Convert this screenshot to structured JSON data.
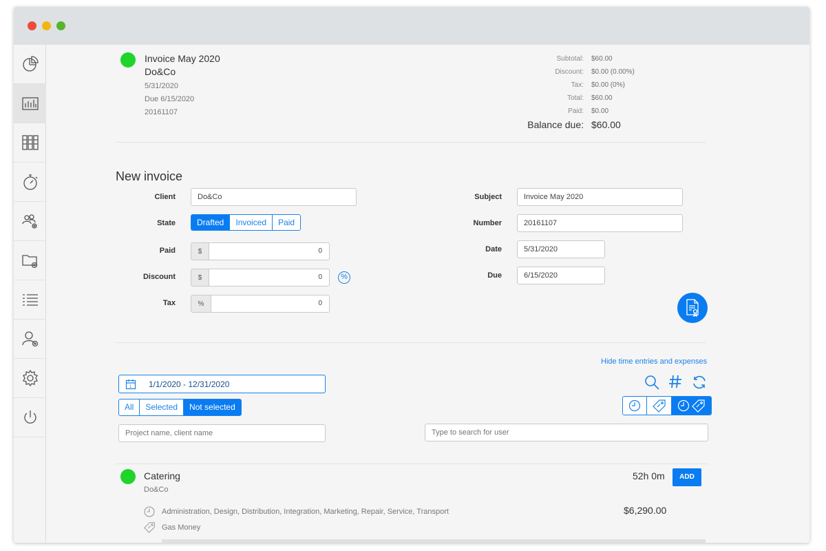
{
  "sidebar": {
    "items": [
      {
        "name": "sidebar-item-dashboard",
        "icon": "pie-chart-icon"
      },
      {
        "name": "sidebar-item-reports",
        "icon": "bar-chart-icon"
      },
      {
        "name": "sidebar-item-invoices",
        "icon": "binders-icon"
      },
      {
        "name": "sidebar-item-timer",
        "icon": "stopwatch-icon"
      },
      {
        "name": "sidebar-item-teams",
        "icon": "people-gear-icon"
      },
      {
        "name": "sidebar-item-projects",
        "icon": "folder-gear-icon"
      },
      {
        "name": "sidebar-item-lists",
        "icon": "list-icon"
      },
      {
        "name": "sidebar-item-users",
        "icon": "user-gear-icon"
      },
      {
        "name": "sidebar-item-settings",
        "icon": "gear-icon"
      },
      {
        "name": "sidebar-item-logout",
        "icon": "power-icon"
      }
    ],
    "active_index": 1
  },
  "invoice_summary": {
    "title": "Invoice May 2020",
    "client": "Do&Co",
    "date": "5/31/2020",
    "due": "Due 6/15/2020",
    "number": "20161107",
    "status_color": "#1fd42b"
  },
  "totals": {
    "subtotal_label": "Subtotal:",
    "subtotal": "$60.00",
    "discount_label": "Discount:",
    "discount": "$0.00 (0.00%)",
    "tax_label": "Tax:",
    "tax": "$0.00 (0%)",
    "total_label": "Total:",
    "total": "$60.00",
    "paid_label": "Paid:",
    "paid": "$0.00",
    "balance_label": "Balance due:",
    "balance": "$60.00"
  },
  "form": {
    "heading": "New invoice",
    "client_label": "Client",
    "client_value": "Do&Co",
    "state_label": "State",
    "states": [
      "Drafted",
      "Invoiced",
      "Paid"
    ],
    "state_selected": "Drafted",
    "paid_label": "Paid",
    "paid_addon": "$",
    "paid_value": "0",
    "discount_label": "Discount",
    "discount_addon": "$",
    "discount_value": "0",
    "discount_toggle": "%",
    "tax_label": "Tax",
    "tax_addon": "%",
    "tax_value": "0",
    "subject_label": "Subject",
    "subject_value": "Invoice May 2020",
    "number_label": "Number",
    "number_value": "20161107",
    "date_label": "Date",
    "date_value": "5/31/2020",
    "due_label": "Due",
    "due_value": "6/15/2020"
  },
  "filters": {
    "hide_link": "Hide time entries and expenses",
    "date_range": "1/1/2020 - 12/31/2020",
    "selection_tabs": [
      "All",
      "Selected",
      "Not selected"
    ],
    "selection_active": "Not selected",
    "project_placeholder": "Project name, client name",
    "user_placeholder": "Type to search for user"
  },
  "entry": {
    "project": "Catering",
    "client": "Do&Co",
    "hours": "52h 0m",
    "add_label": "ADD",
    "tags": "Administration, Design, Distribution, Integration, Marketing, Repair, Service, Transport",
    "amount": "$6,290.00",
    "expense": "Gas Money",
    "status_color": "#1fd42b"
  },
  "colors": {
    "accent": "#0a7cf2",
    "status_green": "#1fd42b"
  }
}
